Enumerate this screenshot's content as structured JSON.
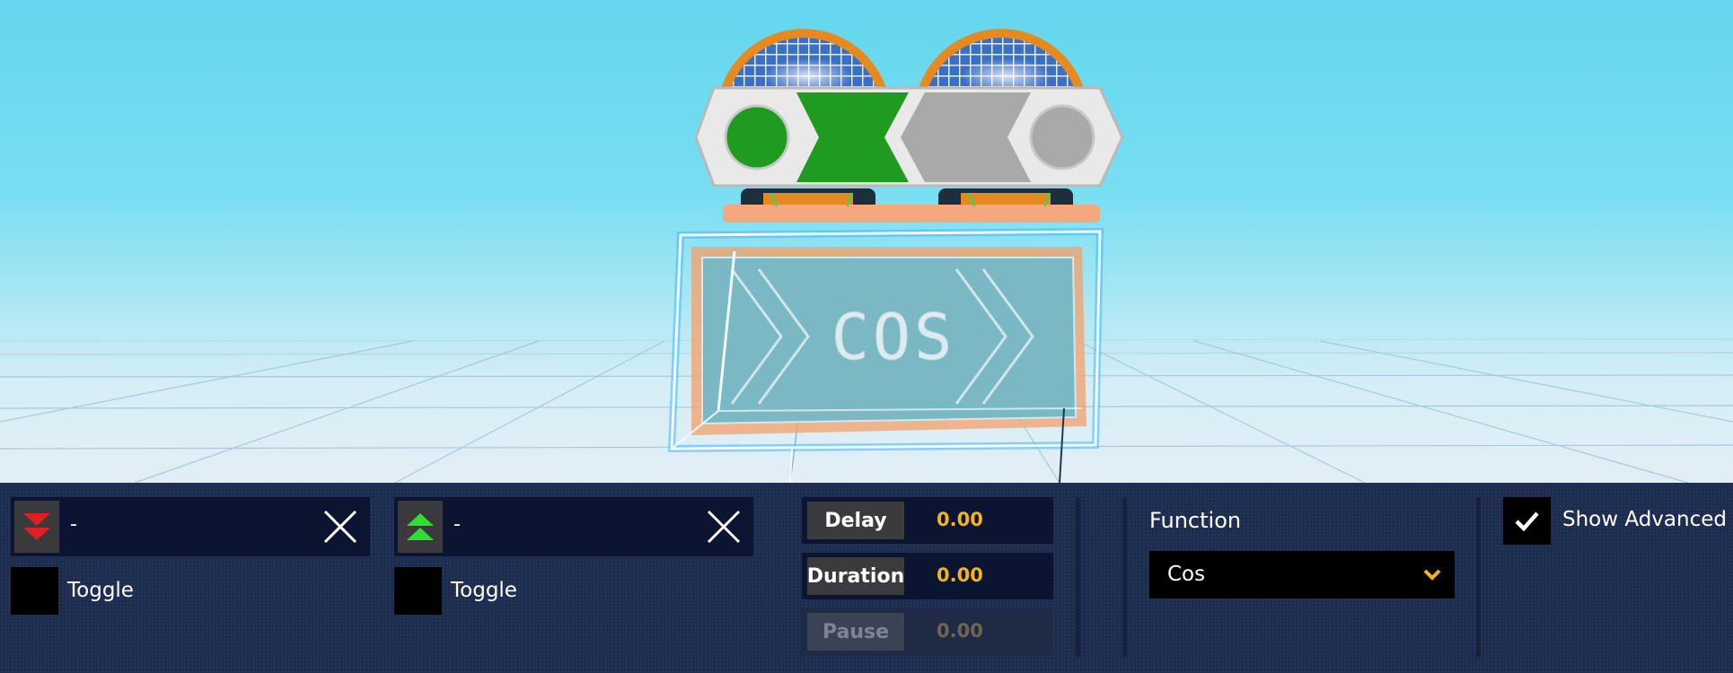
{
  "scene": {
    "display_text": "COS",
    "colors": {
      "sky": "#6fdaf0",
      "floor": "#e2eef6",
      "glow": "#2aa8ff",
      "green": "#1f9b1f",
      "grey": "#a9a9a9",
      "orange": "#f0a040"
    }
  },
  "triggers": {
    "input_1": {
      "icon": "red-double-down-arrow-icon",
      "value": "-",
      "toggle_label": "Toggle"
    },
    "input_2": {
      "icon": "green-double-up-arrow-icon",
      "value": "-",
      "toggle_label": "Toggle"
    }
  },
  "timing": {
    "delay": {
      "label": "Delay",
      "value": "0.00"
    },
    "duration": {
      "label": "Duration",
      "value": "0.00"
    },
    "pause": {
      "label": "Pause",
      "value": "0.00",
      "disabled": true
    }
  },
  "function": {
    "label": "Function",
    "selected": "Cos"
  },
  "advanced": {
    "label": "Show Advanced",
    "checked": true
  },
  "colors": {
    "panel_bg": "#1c2c4f",
    "field_bg": "#0b1430",
    "value_accent": "#f6b21a",
    "chevron_accent": "#f6b21a"
  }
}
